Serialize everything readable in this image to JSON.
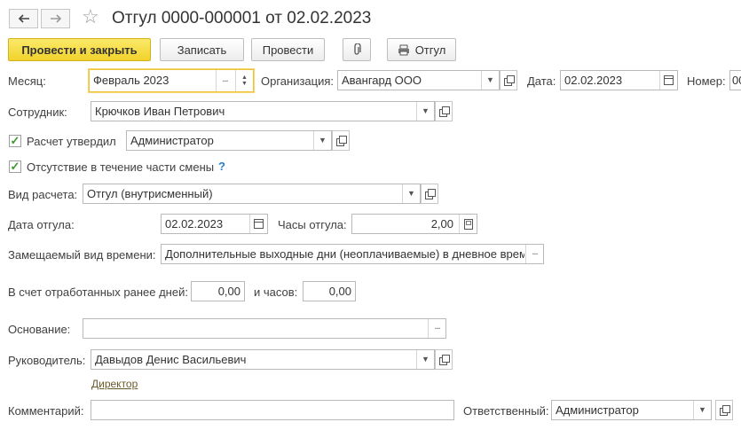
{
  "title": "Отгул 0000-000001 от 02.02.2023",
  "toolbar": {
    "post_close": "Провести и закрыть",
    "save": "Записать",
    "post": "Провести",
    "print": "Отгул"
  },
  "form": {
    "month_label": "Месяц:",
    "month_value": "Февраль 2023",
    "org_label": "Организация:",
    "org_value": "Авангард ООО",
    "date_label": "Дата:",
    "date_value": "02.02.2023",
    "number_label": "Номер:",
    "number_value": "00",
    "employee_label": "Сотрудник:",
    "employee_value": "Крючков Иван Петрович",
    "calc_approved_label": "Расчет утвердил",
    "calc_approved_value": "Администратор",
    "partial_shift_label": "Отсутствие в течение части смены",
    "help": "?",
    "calc_type_label": "Вид расчета:",
    "calc_type_value": "Отгул (внутрисменный)",
    "leave_date_label": "Дата отгула:",
    "leave_date_value": "02.02.2023",
    "leave_hours_label": "Часы отгула:",
    "leave_hours_value": "2,00",
    "replaced_time_label": "Замещаемый вид времени:",
    "replaced_time_value": "Дополнительные выходные дни (неоплачиваемые) в дневное время",
    "worked_days_label": "В счет отработанных ранее дней:",
    "worked_days_value": "0,00",
    "and_hours_label": "и часов:",
    "and_hours_value": "0,00",
    "basis_label": "Основание:",
    "basis_value": "",
    "manager_label": "Руководитель:",
    "manager_value": "Давыдов Денис Васильевич",
    "manager_position": "Директор",
    "comment_label": "Комментарий:",
    "comment_value": "",
    "responsible_label": "Ответственный:",
    "responsible_value": "Администратор"
  },
  "checkboxes": {
    "calc_approved": true,
    "partial_shift": true
  },
  "colors": {
    "primary_button": "#f1d22b",
    "focus_border": "#f0c23a",
    "check": "#3a9a2a",
    "help": "#2b7bd0"
  }
}
